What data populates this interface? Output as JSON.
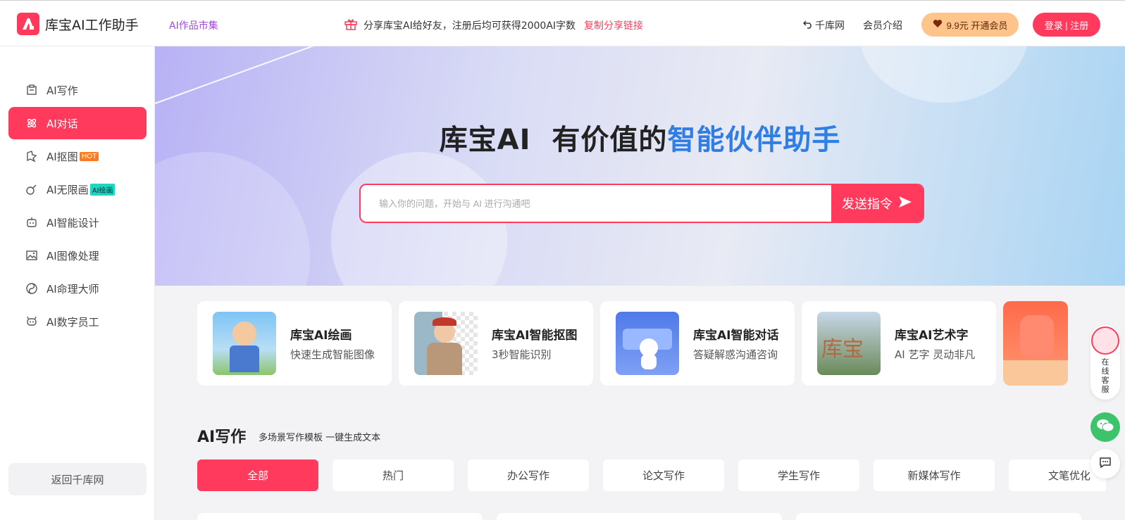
{
  "header": {
    "brand": "库宝AI工作助手",
    "market_link": "AI作品市集",
    "share_text": "分享库宝AI给好友，注册后均可获得2000AI字数",
    "share_link": "复制分享链接",
    "qianku_link": "千库网",
    "member_link": "会员介绍",
    "vip_button": "9.9元 开通会员",
    "login_button": "登录 | 注册"
  },
  "sidebar": {
    "items": [
      {
        "label": "AI写作",
        "icon": "writing-icon"
      },
      {
        "label": "AI对话",
        "icon": "chat-atom-icon"
      },
      {
        "label": "AI抠图",
        "icon": "cutout-icon",
        "tag": "HOT"
      },
      {
        "label": "AI无限画",
        "icon": "paint-icon",
        "tag": "AI绘画"
      },
      {
        "label": "AI智能设计",
        "icon": "robot-icon"
      },
      {
        "label": "AI图像处理",
        "icon": "image-icon"
      },
      {
        "label": "AI命理大师",
        "icon": "fortune-icon"
      },
      {
        "label": "AI数字员工",
        "icon": "digital-worker-icon"
      }
    ],
    "back_button": "返回千库网"
  },
  "hero": {
    "title_main": "库宝AI  有价值的",
    "title_highlight": "智能伙伴助手",
    "search_placeholder": "输入你的问题，开始与 AI 进行沟通吧",
    "send_button": "发送指令"
  },
  "feature_cards": [
    {
      "title": "库宝AI绘画",
      "desc": "快速生成智能图像"
    },
    {
      "title": "库宝AI智能抠图",
      "desc": "3秒智能识别"
    },
    {
      "title": "库宝AI智能对话",
      "desc": "答疑解惑沟通咨询"
    },
    {
      "title": "库宝AI艺术字",
      "desc": "AI 艺字 灵动非凡"
    }
  ],
  "section": {
    "title": "AI写作",
    "subtitle": "多场景写作模板 一键生成文本",
    "categories": [
      "全部",
      "热门",
      "办公写作",
      "论文写作",
      "学生写作",
      "新媒体写作",
      "文笔优化"
    ]
  },
  "float": {
    "customer_service": "在线客服"
  },
  "colors": {
    "accent": "#ff3a5c",
    "highlight": "#2f7ee6",
    "vip": "#ffc48a"
  }
}
